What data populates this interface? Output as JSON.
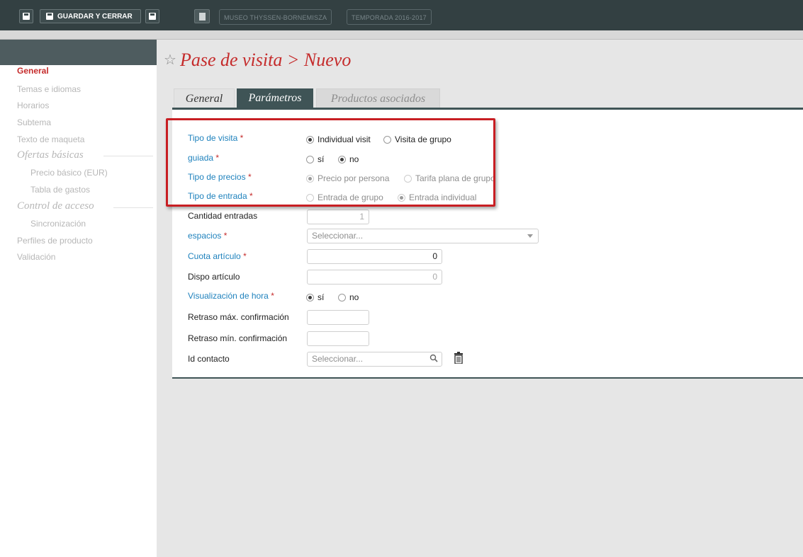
{
  "toolbar": {
    "save_close_label": "GUARDAR Y CERRAR",
    "museum_label": "MUSEO THYSSEN-BORNEMISZA",
    "season_label": "TEMPORADA 2016-2017"
  },
  "sidebar": {
    "items": [
      {
        "label": "General",
        "state": "active"
      },
      {
        "label": "Temas e idiomas"
      },
      {
        "label": "Horarios"
      },
      {
        "label": "Subtema"
      },
      {
        "label": "Texto de maqueta"
      }
    ],
    "section_ofertas": "Ofertas básicas",
    "ofertas_items": [
      "Precio básico (EUR)",
      "Tabla de gastos"
    ],
    "section_control": "Control de acceso",
    "control_items": [
      "Sincronización"
    ],
    "bottom_items": [
      "Perfiles de producto",
      "Validación"
    ]
  },
  "page": {
    "title": "Pase de visita > Nuevo"
  },
  "tabs": [
    {
      "label": "General"
    },
    {
      "label": "Parámetros",
      "active": true
    },
    {
      "label": "Productos asociados"
    }
  ],
  "form": {
    "required_mark": "*",
    "tipo_visita": {
      "label": "Tipo de visita",
      "options": [
        "Individual visit",
        "Visita de grupo"
      ],
      "selected": "Individual visit"
    },
    "guiada": {
      "label": "guiada",
      "options": [
        "sí",
        "no"
      ],
      "selected": "no"
    },
    "tipo_precios": {
      "label": "Tipo de precios",
      "options": [
        "Precio por persona",
        "Tarifa plana de grupo"
      ],
      "selected": "Precio por persona"
    },
    "tipo_entrada": {
      "label": "Tipo de entrada",
      "options": [
        "Entrada de grupo",
        "Entrada individual"
      ],
      "selected": "Entrada individual"
    },
    "cantidad_entradas": {
      "label": "Cantidad entradas",
      "value": "1"
    },
    "espacios": {
      "label": "espacios",
      "placeholder": "Seleccionar..."
    },
    "cuota_articulo": {
      "label": "Cuota artículo",
      "value": "0"
    },
    "dispo_articulo": {
      "label": "Dispo artículo",
      "value": "0"
    },
    "visualizacion_hora": {
      "label": "Visualización de hora",
      "options": [
        "sí",
        "no"
      ],
      "selected": "sí"
    },
    "retraso_max": {
      "label": "Retraso máx. confirmación",
      "value": ""
    },
    "retraso_min": {
      "label": "Retraso mín. confirmación",
      "value": ""
    },
    "id_contacto": {
      "label": "Id contacto",
      "placeholder": "Seleccionar..."
    }
  },
  "colors": {
    "accent_red": "#c52b2b",
    "label_blue": "#1f82bd",
    "tab_active": "#3f5456",
    "topbar": "#334042"
  }
}
